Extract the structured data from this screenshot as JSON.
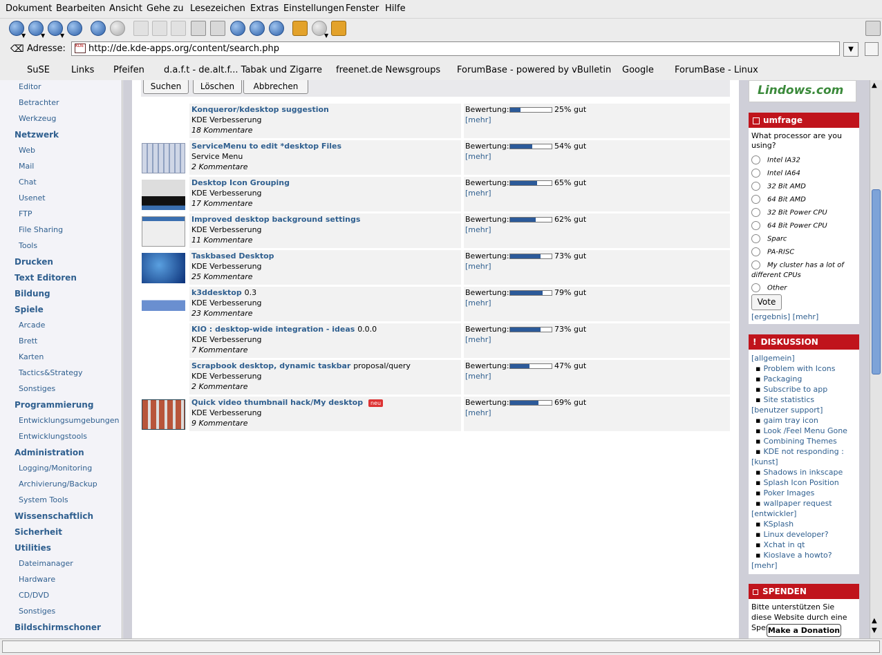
{
  "menu": [
    "Dokument",
    "Bearbeiten",
    "Ansicht",
    "Gehe zu",
    "Lesezeichen",
    "Extras",
    "Einstellungen",
    "Fenster",
    "Hilfe"
  ],
  "address": {
    "label": "Adresse:",
    "url": "http://de.kde-apps.org/content/search.php",
    "favicon_text": "KDE"
  },
  "bookmarks": [
    "SuSE",
    "Links",
    "Pfeifen",
    "d.a.f.t - de.alt.f... Tabak und Zigarre",
    "freenet.de Newsgroups",
    "ForumBase - powered by vBulletin",
    "Google",
    "ForumBase - Linux"
  ],
  "sidebar": {
    "items": [
      {
        "label": "Editor",
        "type": "sub"
      },
      {
        "label": "Betrachter",
        "type": "sub"
      },
      {
        "label": "Werkzeug",
        "type": "sub"
      },
      {
        "label": "Netzwerk",
        "type": "cat"
      },
      {
        "label": "Web",
        "type": "sub"
      },
      {
        "label": "Mail",
        "type": "sub"
      },
      {
        "label": "Chat",
        "type": "sub"
      },
      {
        "label": "Usenet",
        "type": "sub"
      },
      {
        "label": "FTP",
        "type": "sub"
      },
      {
        "label": "File Sharing",
        "type": "sub"
      },
      {
        "label": "Tools",
        "type": "sub"
      },
      {
        "label": "Drucken",
        "type": "cat"
      },
      {
        "label": "Text Editoren",
        "type": "cat"
      },
      {
        "label": "Bildung",
        "type": "cat"
      },
      {
        "label": "Spiele",
        "type": "cat"
      },
      {
        "label": "Arcade",
        "type": "sub"
      },
      {
        "label": "Brett",
        "type": "sub"
      },
      {
        "label": "Karten",
        "type": "sub"
      },
      {
        "label": "Tactics&Strategy",
        "type": "sub"
      },
      {
        "label": "Sonstiges",
        "type": "sub"
      },
      {
        "label": "Programmierung",
        "type": "cat"
      },
      {
        "label": "Entwicklungsumgebungen",
        "type": "sub"
      },
      {
        "label": "Entwicklungstools",
        "type": "sub"
      },
      {
        "label": "Administration",
        "type": "cat"
      },
      {
        "label": "Logging/Monitoring",
        "type": "sub"
      },
      {
        "label": "Archivierung/Backup",
        "type": "sub"
      },
      {
        "label": "System Tools",
        "type": "sub"
      },
      {
        "label": "Wissenschaftlich",
        "type": "cat"
      },
      {
        "label": "Sicherheit",
        "type": "cat"
      },
      {
        "label": "Utilities",
        "type": "cat"
      },
      {
        "label": "Dateimanager",
        "type": "sub"
      },
      {
        "label": "Hardware",
        "type": "sub"
      },
      {
        "label": "CD/DVD",
        "type": "sub"
      },
      {
        "label": "Sonstiges",
        "type": "sub"
      },
      {
        "label": "Bildschirmschoner",
        "type": "cat"
      }
    ]
  },
  "search_buttons": {
    "search": "Suchen",
    "clear": "Löschen",
    "cancel": "Abbrechen"
  },
  "rating_label": "Bewertung:",
  "more_label": "[mehr]",
  "new_badge": "neu",
  "results": [
    {
      "title": "Konqueror/kdesktop suggestion",
      "version": "",
      "category": "KDE Verbesserung",
      "comments": "18 Kommentare",
      "rating": 25,
      "rating_text": "25% gut",
      "thumb": "none",
      "is_new": false
    },
    {
      "title": "ServiceMenu to edit *desktop Files",
      "version": "",
      "category": "Service Menu",
      "comments": "2 Kommentare",
      "rating": 54,
      "rating_text": "54% gut",
      "thumb": "grid",
      "is_new": false
    },
    {
      "title": "Desktop Icon Grouping",
      "version": "",
      "category": "KDE Verbesserung",
      "comments": "17 Kommentare",
      "rating": 65,
      "rating_text": "65% gut",
      "thumb": "desktop-dark",
      "is_new": false
    },
    {
      "title": "Improved desktop background settings",
      "version": "",
      "category": "KDE Verbesserung",
      "comments": "11 Kommentare",
      "rating": 62,
      "rating_text": "62% gut",
      "thumb": "dialog",
      "is_new": false
    },
    {
      "title": "Taskbased Desktop",
      "version": "",
      "category": "KDE Verbesserung",
      "comments": "25 Kommentare",
      "rating": 73,
      "rating_text": "73% gut",
      "thumb": "blue",
      "is_new": false
    },
    {
      "title": "k3ddesktop",
      "version": "0.3",
      "category": "KDE Verbesserung",
      "comments": "23 Kommentare",
      "rating": 79,
      "rating_text": "79% gut",
      "thumb": "strip",
      "is_new": false
    },
    {
      "title": "KIO : desktop-wide integration - ideas",
      "version": "0.0.0",
      "category": "KDE Verbesserung",
      "comments": "7 Kommentare",
      "rating": 73,
      "rating_text": "73% gut",
      "thumb": "none",
      "is_new": false
    },
    {
      "title": "Scrapbook desktop, dynamic taskbar",
      "version": "proposal/query",
      "category": "KDE Verbesserung",
      "comments": "2 Kommentare",
      "rating": 47,
      "rating_text": "47% gut",
      "thumb": "none",
      "is_new": false
    },
    {
      "title": "Quick video thumbnail hack/My desktop",
      "version": "",
      "category": "KDE Verbesserung",
      "comments": "9 Kommentare",
      "rating": 69,
      "rating_text": "69% gut",
      "thumb": "photos",
      "is_new": true
    }
  ],
  "right": {
    "sponsor": "Lindows.com",
    "poll": {
      "title": "umfrage",
      "question": "What processor are you using?",
      "options": [
        "Intel IA32",
        "Intel IA64",
        "32 Bit AMD",
        "64 Bit AMD",
        "32 Bit Power CPU",
        "64 Bit Power CPU",
        "Sparc",
        "PA-RISC",
        "My cluster has a lot of different CPUs",
        "Other"
      ],
      "vote": "Vote",
      "result_link": "[ergebnis]",
      "more_link": "[mehr]"
    },
    "discussion": {
      "title": "DISKUSSION",
      "lines": [
        {
          "text": "[allgemein]",
          "bullet": false
        },
        {
          "text": "Problem with Icons",
          "bullet": true
        },
        {
          "text": "Packaging",
          "bullet": true
        },
        {
          "text": "Subscribe to app",
          "bullet": true
        },
        {
          "text": "Site statistics",
          "bullet": true
        },
        {
          "text": "[benutzer support]",
          "bullet": false
        },
        {
          "text": "gaim tray icon",
          "bullet": true
        },
        {
          "text": "Look /Feel Menu Gone",
          "bullet": true
        },
        {
          "text": "Combining Themes",
          "bullet": true
        },
        {
          "text": "KDE not responding :",
          "bullet": true
        },
        {
          "text": "[kunst]",
          "bullet": false
        },
        {
          "text": "Shadows in inkscape",
          "bullet": true
        },
        {
          "text": "Splash Icon Position",
          "bullet": true
        },
        {
          "text": "Poker Images",
          "bullet": true
        },
        {
          "text": "wallpaper request",
          "bullet": true
        },
        {
          "text": "[entwickler]",
          "bullet": false
        },
        {
          "text": "KSplash",
          "bullet": true
        },
        {
          "text": "Linux developer?",
          "bullet": true
        },
        {
          "text": "Xchat in qt",
          "bullet": true
        },
        {
          "text": "Kioslave a howto?",
          "bullet": true
        },
        {
          "text": "[mehr]",
          "bullet": false
        }
      ]
    },
    "donate": {
      "title": "SPENDEN",
      "text": "Bitte unterstützen Sie diese Website durch eine Spende.",
      "button": "Make a Donation"
    }
  }
}
